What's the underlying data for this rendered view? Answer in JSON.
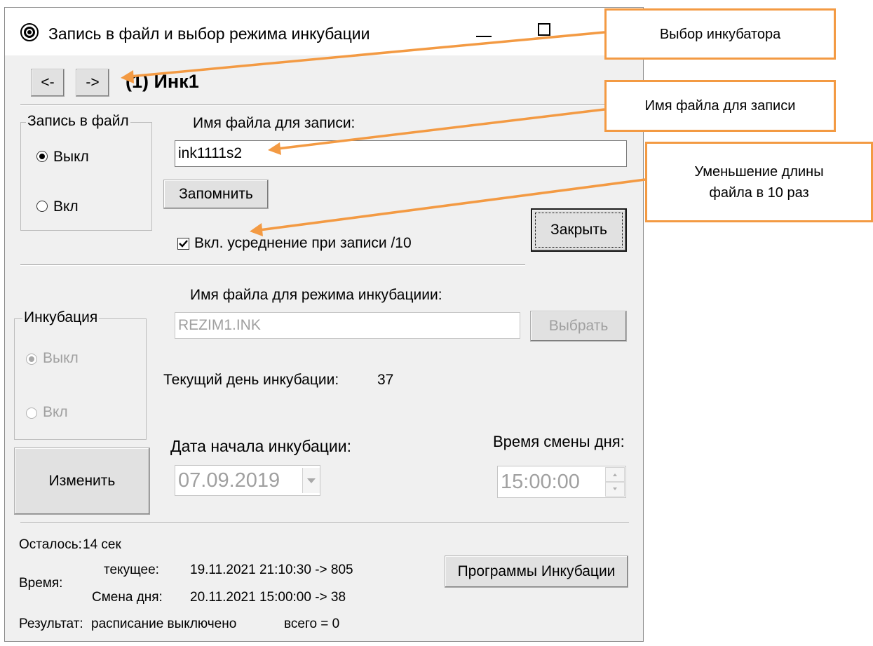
{
  "window": {
    "title": "Запись в файл и выбор режима инкубации"
  },
  "nav": {
    "prev_label": "<-",
    "next_label": "->",
    "incubator_name": "(1) Инк1"
  },
  "record": {
    "group_title": "Запись в файл",
    "off_label": "Выкл",
    "on_label": "Вкл",
    "off_checked": true,
    "filename_label": "Имя файла для записи:",
    "filename_value": "ink1111s2",
    "remember_label": "Запомнить",
    "averaging_label": "Вкл. усреднение при записи /10",
    "averaging_checked": true,
    "close_label": "Закрыть"
  },
  "incubation": {
    "group_title": "Инкубация",
    "off_label": "Выкл",
    "on_label": "Вкл",
    "mode_file_label": "Имя файла для режима инкубациии:",
    "mode_file_value": "REZIM1.INK",
    "choose_label": "Выбрать",
    "current_day_label": "Текущий день инкубации:",
    "current_day_value": "37",
    "change_label": "Изменить",
    "start_date_label": "Дата начала инкубации:",
    "start_date_value": "07.09.2019",
    "day_change_label": "Время смены дня:",
    "day_change_value": "15:00:00"
  },
  "status": {
    "remaining_label": "Осталось:",
    "remaining_value": "14 сек",
    "time_label": "Время:",
    "current_label": "текущее:",
    "current_value": "19.11.2021 21:10:30 -> 805",
    "day_change_label": "Смена дня:",
    "day_change_value": "20.11.2021 15:00:00 -> 38",
    "result_label": "Результат:",
    "result_value": "расписание выключено",
    "total_value": "всего = 0",
    "programs_label": "Программы Инкубации"
  },
  "callouts": {
    "incubator_choice": "Выбор инкубатора",
    "file_name": "Имя файла для записи",
    "length_reduce": "Уменьшение длины файла в 10 раз"
  },
  "colors": {
    "callout_border": "#f39a43",
    "window_bg": "#f0f0f0",
    "disabled_text": "#a0a0a0"
  }
}
